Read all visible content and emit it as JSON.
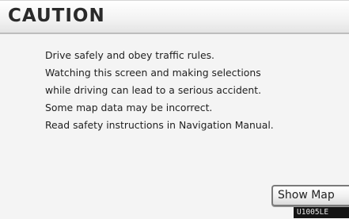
{
  "header": {
    "title": "CAUTION"
  },
  "message": {
    "lines": [
      "Drive safely and obey traffic rules.",
      "Watching this screen and making selections",
      "while driving can lead to a serious accident.",
      "Some map data may be incorrect.",
      "Read safety instructions in Navigation Manual."
    ]
  },
  "actions": {
    "show_map_label": "Show Map"
  },
  "figure_code": "U1005LE"
}
